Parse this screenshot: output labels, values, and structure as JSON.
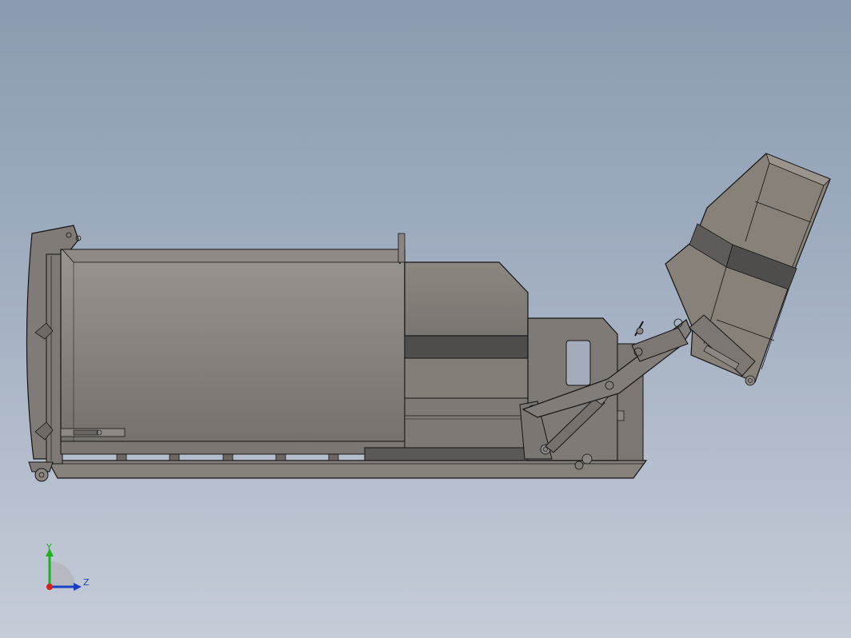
{
  "app": {
    "type": "cad-3d-viewport"
  },
  "model": {
    "name": "",
    "view": "side"
  },
  "triad": {
    "y_label": "Y",
    "z_label": "Z",
    "colors": {
      "y": "#1bb21b",
      "z": "#1b3fc4",
      "x": "#d12020"
    }
  },
  "colors": {
    "background_top": "#8a9bb1",
    "background_bottom": "#c6ccd8",
    "body_fill": "#86807a",
    "body_dark": "#4f4d4b",
    "outline": "#141414"
  }
}
